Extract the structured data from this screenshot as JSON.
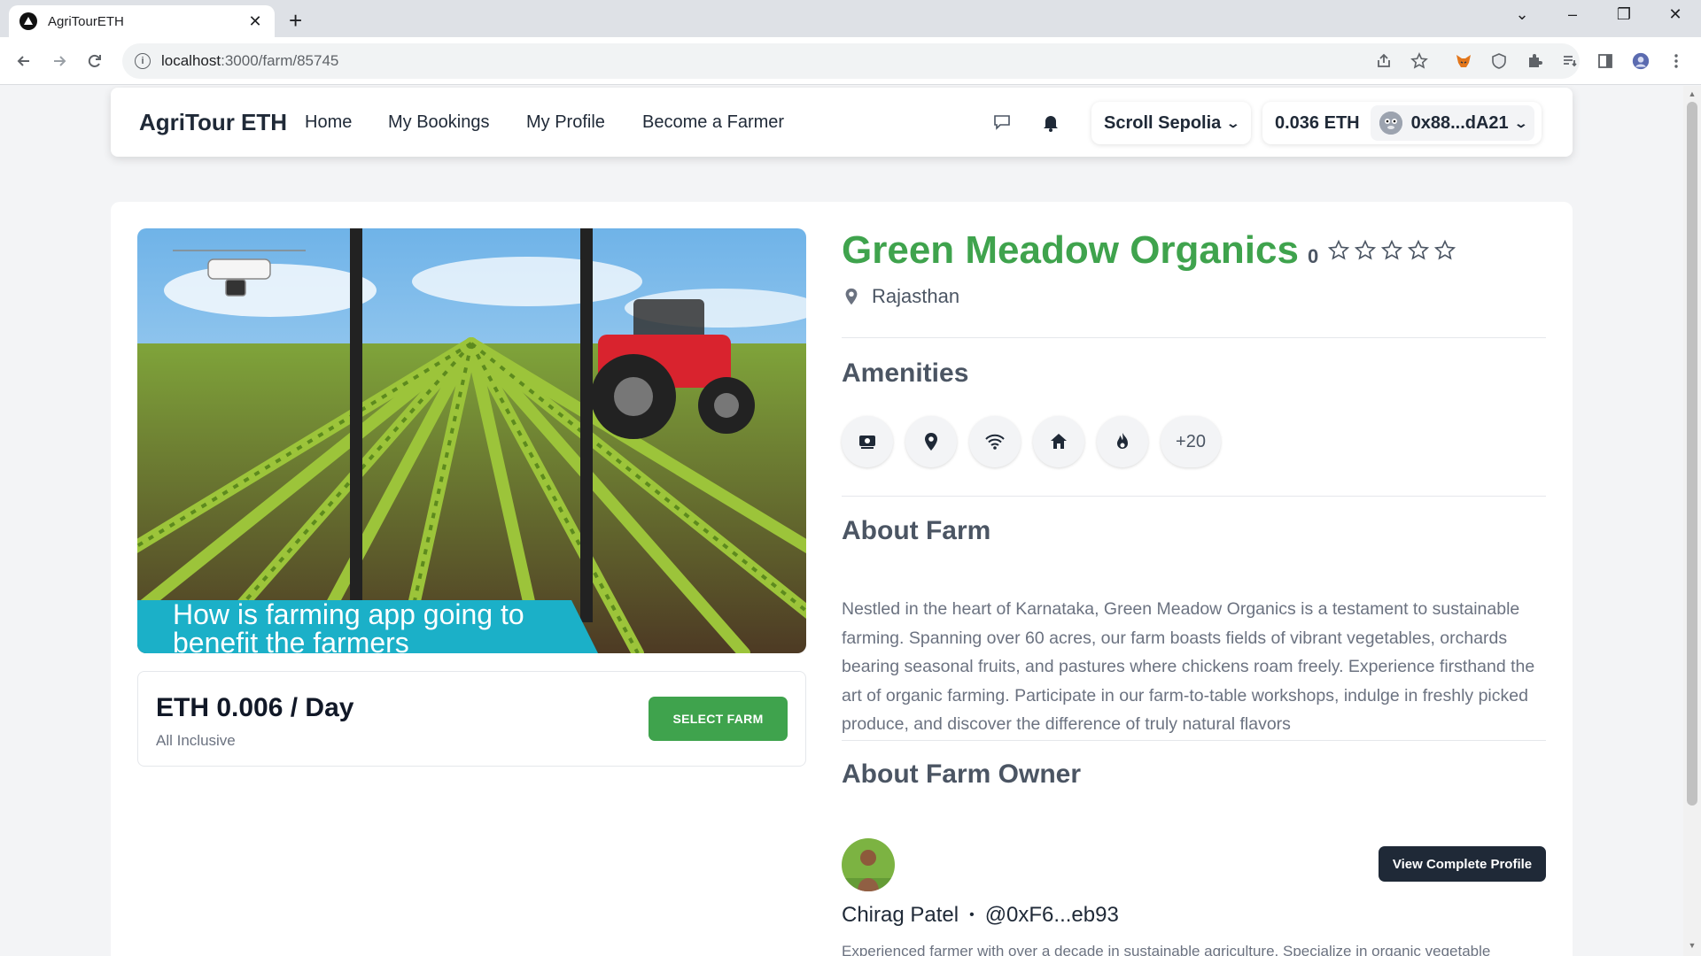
{
  "browser": {
    "tab_title": "AgriTourETH",
    "url_host": "localhost",
    "url_path": ":3000/farm/85745"
  },
  "header": {
    "brand": "AgriTour ETH",
    "nav": [
      "Home",
      "My Bookings",
      "My Profile",
      "Become a Farmer"
    ],
    "network": "Scroll Sepolia",
    "balance": "0.036 ETH",
    "account": "0x88...dA21"
  },
  "farm": {
    "name": "Green Meadow Organics",
    "rating": "0",
    "rating_stars": 0,
    "stars_total": 5,
    "location": "Rajasthan",
    "image_caption": "How is farming app going to benefit the farmers",
    "price": "ETH 0.006 / Day",
    "price_note": "All Inclusive",
    "select_label": "SELECT FARM",
    "amenities_title": "Amenities",
    "amenities_icons": [
      "money-icon",
      "location-pin-icon",
      "wifi-icon",
      "home-icon",
      "fire-icon"
    ],
    "amenities_more": "+20",
    "about_title": "About Farm",
    "about_text": "Nestled in the heart of Karnataka, Green Meadow Organics is a testament to sustainable farming. Spanning over 60 acres, our farm boasts fields of vibrant vegetables, orchards bearing seasonal fruits, and pastures where chickens roam freely. Experience firsthand the art of organic farming. Participate in our farm-to-table workshops, indulge in freshly picked produce, and discover the difference of truly natural flavors"
  },
  "owner": {
    "section_title": "About Farm Owner",
    "name": "Chirag Patel",
    "handle": "@0xF6...eb93",
    "view_label": "View Complete Profile",
    "bio": "Experienced farmer with over a decade in sustainable agriculture. Specialize in organic vegetable cultivation and free-range poultry farming. Committed to eco-friendly practices, nurturing the soil, and"
  },
  "colors": {
    "accent_green": "#3fa34d",
    "dark_button": "#1f2937"
  }
}
